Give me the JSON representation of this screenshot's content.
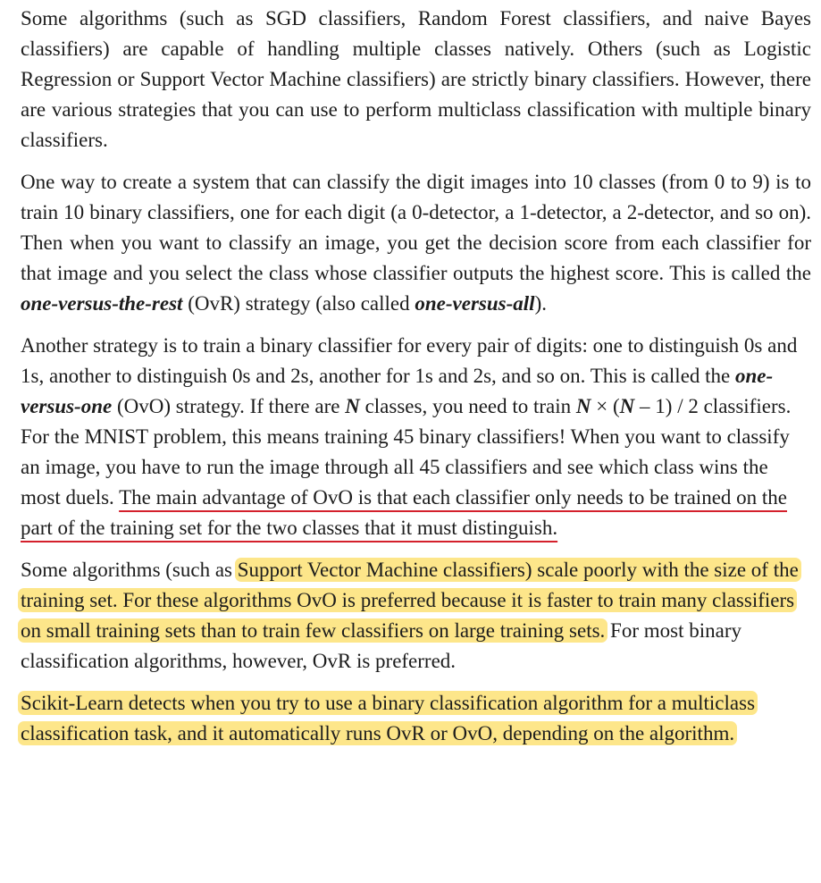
{
  "paragraphs": {
    "p1": "Some algorithms (such as SGD classifiers, Random Forest classifiers, and naive Bayes classifiers) are capable of handling multiple classes natively. Others (such as Logistic Regression or Support Vector Machine classifiers) are strictly binary classifiers. However, there are various strategies that you can use to perform multiclass classification with multiple binary classifiers.",
    "p2": {
      "a": "One way to create a system that can classify the digit images into 10 classes (from 0 to 9) is to train 10 binary classifiers, one for each digit (a 0-detector, a 1-detector, a 2-detector, and so on). Then when you want to classify an image, you get the decision score from each classifier for that image and you select the class whose classifier outputs the highest score. This is called the ",
      "term1": "one-versus-the-rest",
      "b": " (OvR) strategy (also called ",
      "term2": "one-versus-all",
      "c": ")."
    },
    "p3": {
      "a": "Another strategy is to train a binary classifier for every pair of digits: one to distinguish 0s and 1s, another to distinguish 0s and 2s, another for 1s and 2s, and so on. This is called the ",
      "term": "one-versus-one",
      "b": " (OvO) strategy. If there are ",
      "n1": "N",
      "c": " classes, you need to train ",
      "n2": "N",
      "d": " × (",
      "n3": "N",
      "e": " – 1) / 2 classifiers. For the MNIST problem, this means training 45 binary classifiers! When you want to classify an image, you have to run the image through all 45 classifiers and see which class wins the most duels. ",
      "underlined": "The main advantage of OvO is that each classifier only needs to be trained on the part of the training set for the two classes that it must distinguish."
    },
    "p4": {
      "a": "Some algorithms (such as ",
      "highlight": "Support Vector Machine classifiers) scale poorly with the size of the training set. For these algorithms OvO is preferred because it is faster to train many classifiers on small training sets than to train few classifiers on large training sets.",
      "b": " For most binary classification algorithms, however, OvR is preferred."
    },
    "p5": {
      "highlight": "Scikit-Learn detects when you try to use a binary classification algorithm for a multiclass classification task, and it automatically runs OvR or OvO, depending on the algorithm."
    }
  },
  "colors": {
    "text": "#1c1c1c",
    "highlight": "#fde68a",
    "underline": "#d4202c"
  }
}
